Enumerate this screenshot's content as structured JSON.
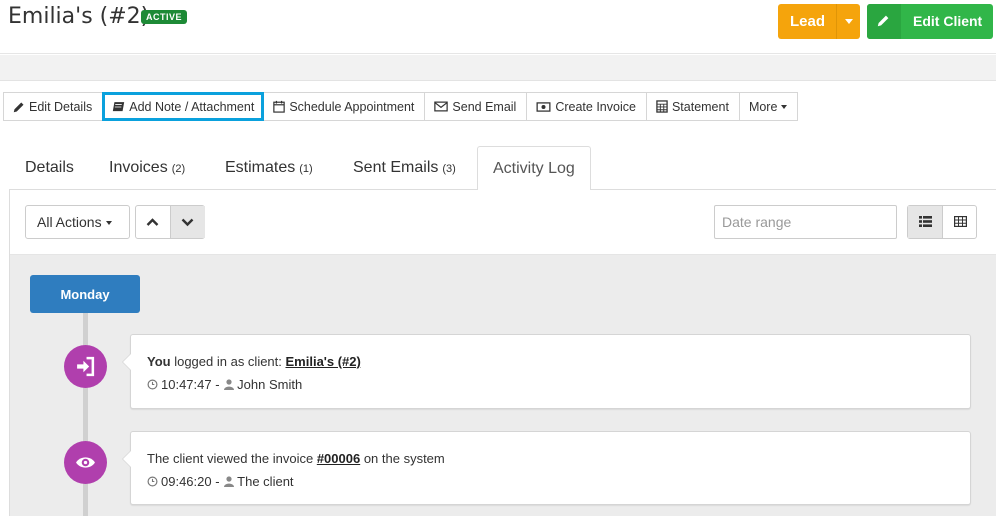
{
  "header": {
    "title": "Emilia's (#2)",
    "status_badge": "ACTIVE",
    "lead_label": "Lead",
    "edit_client_label": "Edit Client",
    "colors": {
      "lead": "#f5a40c",
      "edit_client": "#31b649",
      "badge": "#1d8a36"
    }
  },
  "toolbar": {
    "items": [
      {
        "label": "Edit Details",
        "icon": "pencil-icon"
      },
      {
        "label": "Add Note / Attachment",
        "icon": "book-icon"
      },
      {
        "label": "Schedule Appointment",
        "icon": "calendar-icon"
      },
      {
        "label": "Send Email",
        "icon": "envelope-icon"
      },
      {
        "label": "Create Invoice",
        "icon": "money-icon"
      },
      {
        "label": "Statement",
        "icon": "table-icon"
      },
      {
        "label": "More",
        "icon": "caret-down-icon"
      }
    ],
    "highlight_color": "#0aa1dd"
  },
  "tabs": [
    {
      "label": "Details",
      "count": ""
    },
    {
      "label": "Invoices",
      "count": "(2)"
    },
    {
      "label": "Estimates",
      "count": "(1)"
    },
    {
      "label": "Sent Emails",
      "count": "(3)"
    },
    {
      "label": "Activity Log",
      "count": "",
      "active": true
    }
  ],
  "filters": {
    "all_actions_label": "All Actions",
    "date_range_placeholder": "Date range"
  },
  "timeline": {
    "day_label": "Monday",
    "day_color": "#2f7dbf",
    "event_icon_color": "#b03fad",
    "entries": [
      {
        "icon": "sign-in-icon",
        "actor": "You",
        "text": " logged in as client: ",
        "link": "Emilia's (#2)",
        "text_after": "",
        "time": "10:47:47",
        "separator": " - ",
        "user": "John Smith"
      },
      {
        "icon": "eye-icon",
        "actor": "",
        "text": "The client viewed the invoice ",
        "link": "#00006",
        "text_after": " on the system",
        "time": "09:46:20",
        "separator": " - ",
        "user": "The client"
      }
    ]
  }
}
